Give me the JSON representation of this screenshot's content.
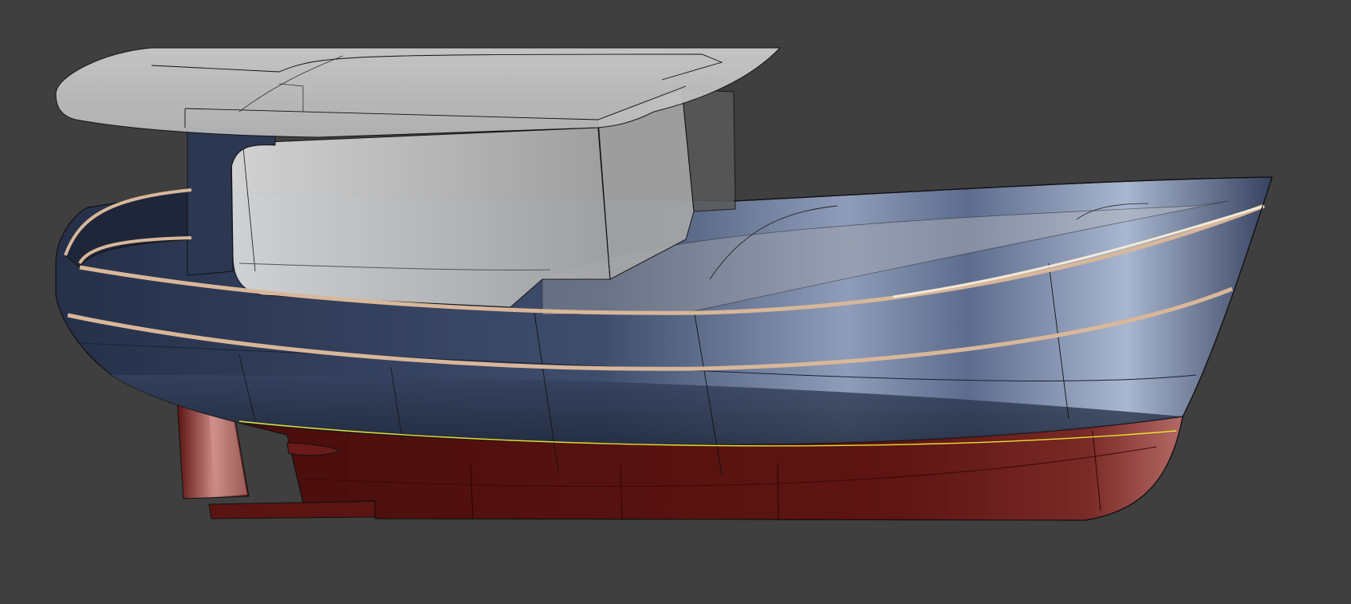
{
  "viewport": {
    "background_color": "#3f3f3f",
    "subject": "3d-boat-hull-render"
  },
  "colors": {
    "hull_topside": "#2d3a55",
    "hull_topside_highlight": "#a9b6cf",
    "antifouling_bottom": "#5a1412",
    "antifouling_highlight": "#b0625e",
    "cabin_glass": "#c9c9c9",
    "roof": "#d4d4d4",
    "rub_rail": "#d8b79a",
    "waterline": "#e6e030",
    "edge_lines": "#111111"
  }
}
